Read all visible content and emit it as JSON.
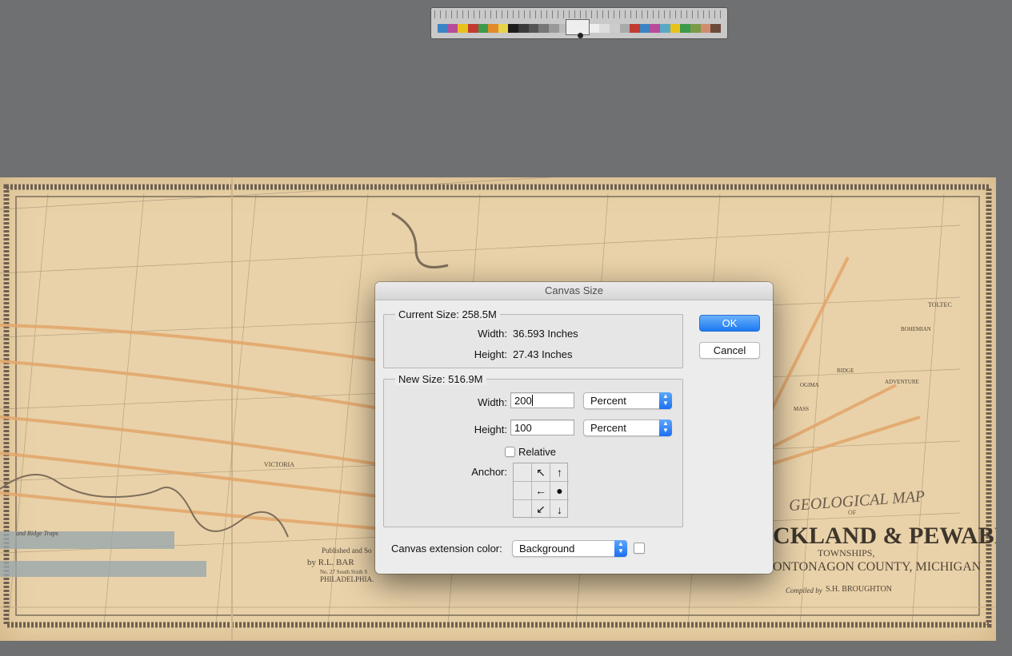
{
  "dialog": {
    "title": "Canvas Size",
    "current_size": {
      "label": "Current Size: 258.5M",
      "width_label": "Width:",
      "width_value": "36.593 Inches",
      "height_label": "Height:",
      "height_value": "27.43 Inches"
    },
    "new_size": {
      "label": "New Size: 516.9M",
      "width_label": "Width:",
      "width_value": "200",
      "width_unit": "Percent",
      "height_label": "Height:",
      "height_value": "100",
      "height_unit": "Percent",
      "relative_label": "Relative",
      "relative_checked": false,
      "anchor_label": "Anchor:"
    },
    "extension_color_label": "Canvas extension color:",
    "extension_color_value": "Background",
    "ok_label": "OK",
    "cancel_label": "Cancel"
  },
  "background_map": {
    "title_line1": "GEOLOGICAL MAP",
    "title_of": "OF",
    "title_line2": "CKLAND & PEWABIC",
    "title_line3": "TOWNSHIPS,",
    "title_line4": "ONTONAGON COUNTY, MICHIGAN",
    "compiled_by": "Compiled by",
    "author": "S.H. BROUGHTON",
    "published_line1": "Published and So",
    "published_by": "by R.L. BAR",
    "publisher_address": "No. 27 South Sixth S",
    "publisher_city": "PHILADELPHIA.",
    "place_victoria": "VICTORIA",
    "place_ridge": "RIDGE",
    "place_ogima": "OGIMA",
    "place_mass": "MASS",
    "place_adventure": "ADVENTURE",
    "place_bohemian": "BOHEMIAN",
    "place_toltec": "TOLTEC",
    "profile_caption": "and Ridge Traps"
  },
  "colors": {
    "accent": "#1c79f1",
    "map_paper": "#e9d2a9",
    "vein": "#e3a66a",
    "workspace": "#6f7071"
  }
}
